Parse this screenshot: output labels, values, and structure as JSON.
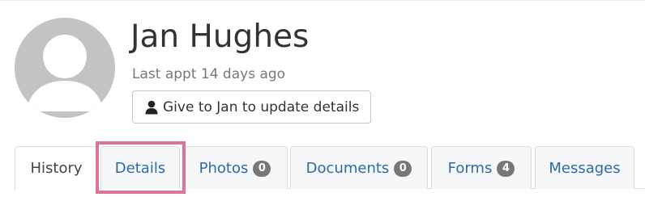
{
  "profile": {
    "name": "Jan Hughes",
    "last_appt": "Last appt 14 days ago",
    "update_button_label": "Give to Jan to update details"
  },
  "tabs": [
    {
      "label": "History",
      "active": true
    },
    {
      "label": "Details",
      "highlighted": true
    },
    {
      "label": "Photos",
      "badge": "0"
    },
    {
      "label": "Documents",
      "badge": "0"
    },
    {
      "label": "Forms",
      "badge": "4"
    },
    {
      "label": "Messages"
    }
  ],
  "icons": {
    "avatar": "default-user-avatar-icon",
    "update_button": "user-icon"
  },
  "colors": {
    "link": "#2d6aa6",
    "badge_bg": "#777777",
    "highlight": "#de7393",
    "avatar_bg": "#c3c3c3"
  }
}
